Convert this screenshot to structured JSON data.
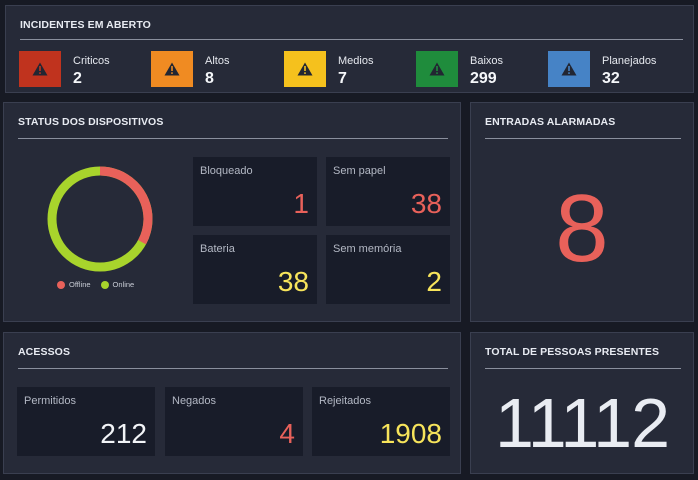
{
  "colors": {
    "red": "#e8615a",
    "green": "#a8d42c",
    "yellow": "#f7e45b",
    "critico": "#c0331e",
    "alto": "#f08b22",
    "medio": "#f5c11d",
    "baixo": "#1f8c3c",
    "planejado": "#4683c6"
  },
  "incidents": {
    "title": "INCIDENTES EM ABERTO",
    "items": [
      {
        "label": "Criticos",
        "count": "2",
        "icon": "warning-icon"
      },
      {
        "label": "Altos",
        "count": "8",
        "icon": "warning-icon"
      },
      {
        "label": "Medios",
        "count": "7",
        "icon": "warning-icon"
      },
      {
        "label": "Baixos",
        "count": "299",
        "icon": "warning-icon"
      },
      {
        "label": "Planejados",
        "count": "32",
        "icon": "warning-icon"
      }
    ]
  },
  "devices": {
    "title": "STATUS DOS DISPOSITIVOS",
    "donut": {
      "offline_fraction": 0.33,
      "online_fraction": 0.67
    },
    "legend": {
      "offline": "Offline",
      "online": "Online"
    },
    "tiles": [
      {
        "label": "Bloqueado",
        "value": "1"
      },
      {
        "label": "Sem papel",
        "value": "38"
      },
      {
        "label": "Bateria",
        "value": "38"
      },
      {
        "label": "Sem memória",
        "value": "2"
      }
    ]
  },
  "alarmed": {
    "title": "ENTRADAS ALARMADAS",
    "value": "8"
  },
  "access": {
    "title": "ACESSOS",
    "tiles": [
      {
        "label": "Permitidos",
        "value": "212"
      },
      {
        "label": "Negados",
        "value": "4"
      },
      {
        "label": "Rejeitados",
        "value": "1908"
      }
    ]
  },
  "people": {
    "title": "TOTAL DE PESSOAS PRESENTES",
    "value": "11112"
  }
}
